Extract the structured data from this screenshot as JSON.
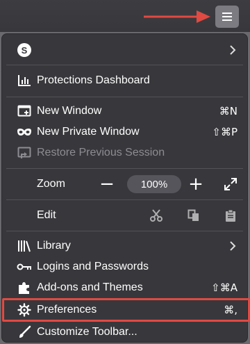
{
  "colors": {
    "panel_bg": "#38383c",
    "toolbar_bg": "#3b3b3f",
    "separator": "#525257",
    "annotation_red": "#e04a43",
    "disabled_text": "#8c8c92"
  },
  "toolbar": {
    "menu_button_icon": "hamburger-icon"
  },
  "account": {
    "avatar_letter": "S"
  },
  "menu": {
    "protections": {
      "label": "Protections Dashboard",
      "icon": "bar-chart-icon"
    },
    "new_window": {
      "label": "New Window",
      "shortcut": "⌘N",
      "icon": "new-window-icon"
    },
    "new_private_window": {
      "label": "New Private Window",
      "shortcut": "⇧⌘P",
      "icon": "mask-icon"
    },
    "restore_session": {
      "label": "Restore Previous Session",
      "icon": "restore-icon",
      "disabled": true
    },
    "zoom": {
      "label": "Zoom",
      "minus": "−",
      "level": "100%",
      "plus": "+",
      "fullscreen_icon": "expand-icon"
    },
    "edit": {
      "label": "Edit",
      "cut_icon": "scissors-icon",
      "copy_icon": "copy-icon",
      "paste_icon": "clipboard-icon"
    },
    "library": {
      "label": "Library",
      "icon": "library-icon"
    },
    "logins": {
      "label": "Logins and Passwords",
      "icon": "key-icon"
    },
    "addons": {
      "label": "Add-ons and Themes",
      "shortcut": "⇧⌘A",
      "icon": "puzzle-icon"
    },
    "preferences": {
      "label": "Preferences",
      "shortcut": "⌘,",
      "icon": "gear-icon",
      "highlighted": true
    },
    "customize": {
      "label": "Customize Toolbar...",
      "icon": "brush-icon"
    }
  }
}
